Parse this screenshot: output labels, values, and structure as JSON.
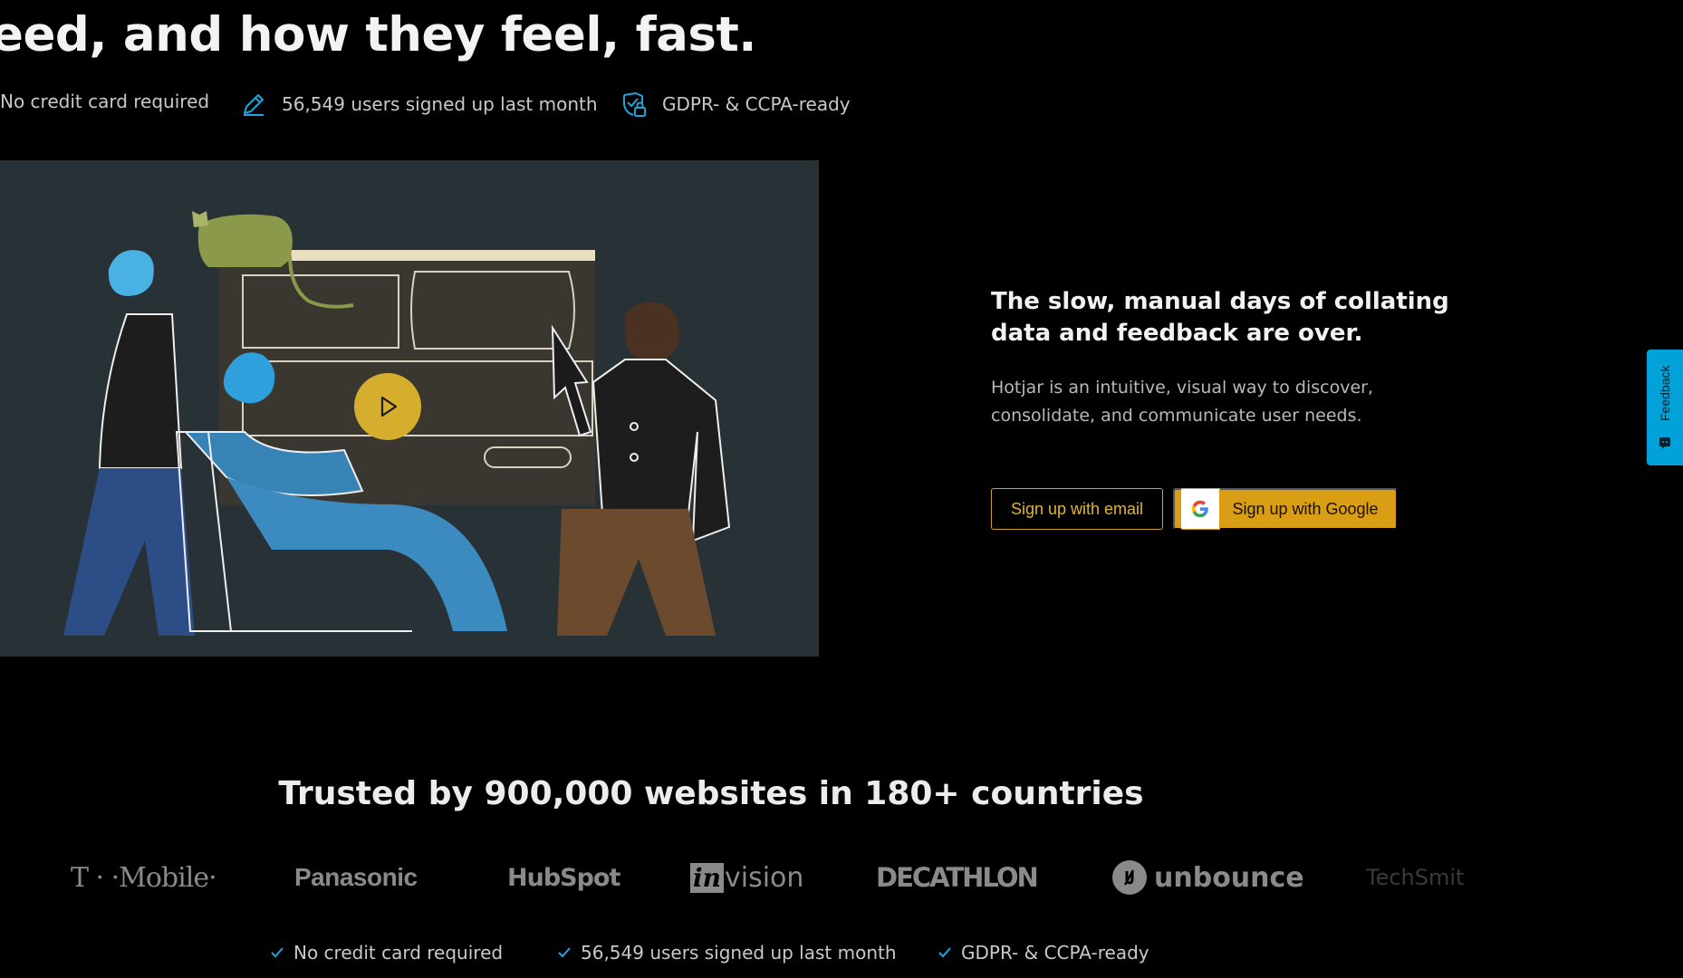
{
  "hero": {
    "title": "eed, and how they feel, fast."
  },
  "trust_badges": [
    {
      "label": "No credit card required",
      "icon": "credit-card-icon"
    },
    {
      "label": "56,549 users signed up last month",
      "icon": "pencil-icon"
    },
    {
      "label": "GDPR- & CCPA-ready",
      "icon": "shield-lock-icon"
    }
  ],
  "video": {
    "play_icon": "play-icon"
  },
  "intro": {
    "heading": "The slow, manual days of collating data and feedback are over.",
    "text": "Hotjar is an intuitive, visual way to discover, consolidate, and communicate user needs."
  },
  "cta": {
    "email_label": "Sign up with email",
    "google_label": "Sign up with Google"
  },
  "feedback": {
    "label": "Feedback"
  },
  "trusted": {
    "heading": "Trusted by 900,000 websites in 180+ countries",
    "logos": {
      "tmobile": "T · ·Mobile·",
      "panasonic": "Panasonic",
      "hubspot": "HubSpot",
      "invision_box": "in",
      "invision_rest": "vision",
      "decathlon": "DECATHLON",
      "unbounce": "unbounce",
      "techsmith": "TechSmith"
    }
  },
  "bottom_badges": [
    {
      "label": "No credit card required"
    },
    {
      "label": "56,549 users signed up last month"
    },
    {
      "label": "GDPR- & CCPA-ready"
    }
  ],
  "colors": {
    "background": "#000000",
    "accent_yellow": "#d99e14",
    "feedback_blue": "#00a2d9",
    "icon_blue": "#1ea5e0"
  }
}
